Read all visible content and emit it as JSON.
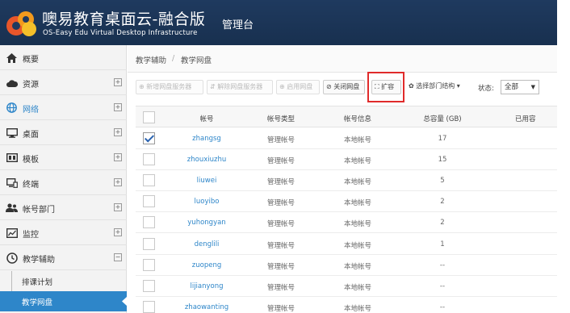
{
  "header": {
    "title": "噢易教育桌面云-融合版",
    "subtitle": "OS-Easy Edu Virtual Desktop Infrastructure",
    "console": "管理台"
  },
  "sidebar": {
    "items": [
      {
        "label": "概要",
        "icon": "home-icon",
        "expandable": false
      },
      {
        "label": "资源",
        "icon": "cloud-icon",
        "expandable": true
      },
      {
        "label": "网络",
        "icon": "globe-icon",
        "expandable": true,
        "active": true
      },
      {
        "label": "桌面",
        "icon": "monitor-icon",
        "expandable": true
      },
      {
        "label": "模板",
        "icon": "template-icon",
        "expandable": true
      },
      {
        "label": "终端",
        "icon": "terminal-icon",
        "expandable": true
      },
      {
        "label": "帐号部门",
        "icon": "users-icon",
        "expandable": true
      },
      {
        "label": "监控",
        "icon": "chart-icon",
        "expandable": true
      },
      {
        "label": "教学辅助",
        "icon": "clock-icon",
        "expandable": true,
        "expanded": true
      }
    ],
    "subitems": [
      {
        "label": "排课计划",
        "current": false
      },
      {
        "label": "教学网盘",
        "current": true
      }
    ]
  },
  "breadcrumb": {
    "parent": "教学辅助",
    "separator": "/",
    "current": "教学网盘"
  },
  "toolbar": {
    "buttons": [
      {
        "label": "⊕ 新增网盘服务器",
        "enabled": false
      },
      {
        "label": "⇵ 解除网盘服务器",
        "enabled": false
      },
      {
        "label": "⊕ 启用网盘",
        "enabled": false
      },
      {
        "label": "⊘ 关闭网盘",
        "enabled": true
      },
      {
        "label": "⛶ 扩容",
        "enabled": true
      },
      {
        "label": "✿ 选择部门结构 ▾",
        "enabled": true
      }
    ],
    "status_label": "状态:",
    "status_value": "全部"
  },
  "table": {
    "columns": [
      "帐号",
      "帐号类型",
      "帐号信息",
      "总容量 (GB)",
      "已用容"
    ],
    "rows": [
      {
        "checked": true,
        "account": "zhangsg",
        "type": "管理帐号",
        "info": "本地帐号",
        "capacity": "17"
      },
      {
        "checked": false,
        "account": "zhouxiuzhu",
        "type": "管理帐号",
        "info": "本地帐号",
        "capacity": "15"
      },
      {
        "checked": false,
        "account": "liuwei",
        "type": "管理帐号",
        "info": "本地帐号",
        "capacity": "5"
      },
      {
        "checked": false,
        "account": "luoyibo",
        "type": "管理帐号",
        "info": "本地帐号",
        "capacity": "2"
      },
      {
        "checked": false,
        "account": "yuhongyan",
        "type": "管理帐号",
        "info": "本地帐号",
        "capacity": "2"
      },
      {
        "checked": false,
        "account": "denglili",
        "type": "管理帐号",
        "info": "本地帐号",
        "capacity": "1"
      },
      {
        "checked": false,
        "account": "zuopeng",
        "type": "管理帐号",
        "info": "本地帐号",
        "capacity": "--"
      },
      {
        "checked": false,
        "account": "lijianyong",
        "type": "管理帐号",
        "info": "本地帐号",
        "capacity": "--"
      },
      {
        "checked": false,
        "account": "zhaowanting",
        "type": "管理帐号",
        "info": "本地帐号",
        "capacity": "--"
      }
    ]
  },
  "colors": {
    "header_bg": "#1f3a5f",
    "accent": "#2e86c9",
    "highlight_box": "#e02b2b"
  }
}
